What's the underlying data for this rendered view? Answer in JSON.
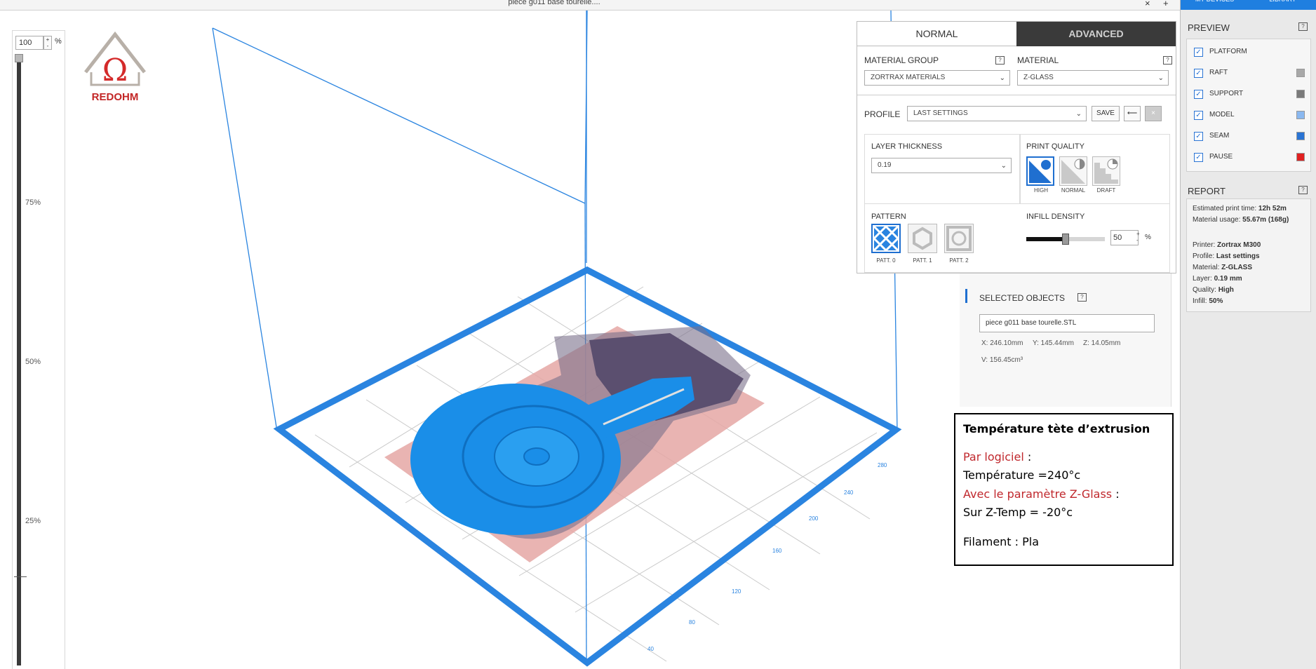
{
  "window": {
    "title": "piece g011 base tourelle....",
    "close_glyph": "×",
    "add_glyph": "+"
  },
  "zoom": {
    "value": "100",
    "pct_symbol": "%",
    "spin_up": "+",
    "spin_down": "-",
    "ticks": [
      "75%",
      "50%",
      "25%"
    ]
  },
  "logo": {
    "text": "REDOHM",
    "symbol": "Ω"
  },
  "settings": {
    "tabs": {
      "normal": "NORMAL",
      "advanced": "ADVANCED"
    },
    "material_group_label": "MATERIAL GROUP",
    "material_group_value": "ZORTRAX MATERIALS",
    "material_label": "MATERIAL",
    "material_value": "Z-GLASS",
    "help_glyph": "?",
    "profile_label": "PROFILE",
    "profile_value": "LAST SETTINGS",
    "save_label": "SAVE",
    "undo_glyph": "⟵",
    "close_glyph": "×",
    "layer_thickness_label": "LAYER THICKNESS",
    "layer_thickness_value": "0.19",
    "print_quality_label": "PRINT QUALITY",
    "quality_options": [
      "HIGH",
      "NORMAL",
      "DRAFT"
    ],
    "pattern_label": "PATTERN",
    "pattern_options": [
      "PATT. 0",
      "PATT. 1",
      "PATT. 2"
    ],
    "infill_label": "INFILL DENSITY",
    "infill_value": "50",
    "infill_pct_symbol": "%",
    "infill_fraction": 0.5
  },
  "selected_objects": {
    "title": "SELECTED OBJECTS",
    "filename": "piece g011 base tourelle.STL",
    "x": "X: 246.10mm",
    "y": "Y: 145.44mm",
    "z": "Z: 14.05mm",
    "v": "V: 156.45cm³"
  },
  "note": {
    "title": "Température tète d’extrusion",
    "line1_red": "Par logiciel",
    "line1_black": " :",
    "line2": "Température =240°c",
    "line3_red": "Avec le paramètre Z-Glass",
    "line3_black": " :",
    "line4": "Sur Z-Temp = -20°c",
    "line5": "Filament : Pla",
    "red_color": "#c0282d"
  },
  "right_panel": {
    "tabs": [
      "MY DEVICES",
      "LIBRARY"
    ],
    "preview_title": "PREVIEW",
    "help_glyph": "?",
    "preview_items": [
      {
        "label": "PLATFORM",
        "color": ""
      },
      {
        "label": "RAFT",
        "color": "#a8a8a8"
      },
      {
        "label": "SUPPORT",
        "color": "#7a7a7a"
      },
      {
        "label": "MODEL",
        "color": "#8ab8f0"
      },
      {
        "label": "SEAM",
        "color": "#2a74d4"
      },
      {
        "label": "PAUSE",
        "color": "#e02020"
      }
    ],
    "check_glyph": "✓",
    "report_title": "REPORT",
    "report": {
      "time_label": "Estimated print time: ",
      "time_value": "12h 52m",
      "material_label": "Material usage: ",
      "material_value": "55.67m (168g)",
      "printer_label": "Printer: ",
      "printer_value": "Zortrax M300",
      "profile_label": "Profile: ",
      "profile_value": "Last settings",
      "mat_label": "Material: ",
      "mat_value": "Z-GLASS",
      "layer_label": "Layer: ",
      "layer_value": "0.19 mm",
      "quality_label": "Quality: ",
      "quality_value": "High",
      "infill_label": "Infill: ",
      "infill_value": "50%"
    }
  },
  "platform_axis_labels": [
    "40",
    "80",
    "120",
    "160",
    "200",
    "240",
    "280"
  ],
  "colors": {
    "accent": "#2a84e0",
    "model": "#1a8ee8",
    "raft": "#d98a86"
  }
}
